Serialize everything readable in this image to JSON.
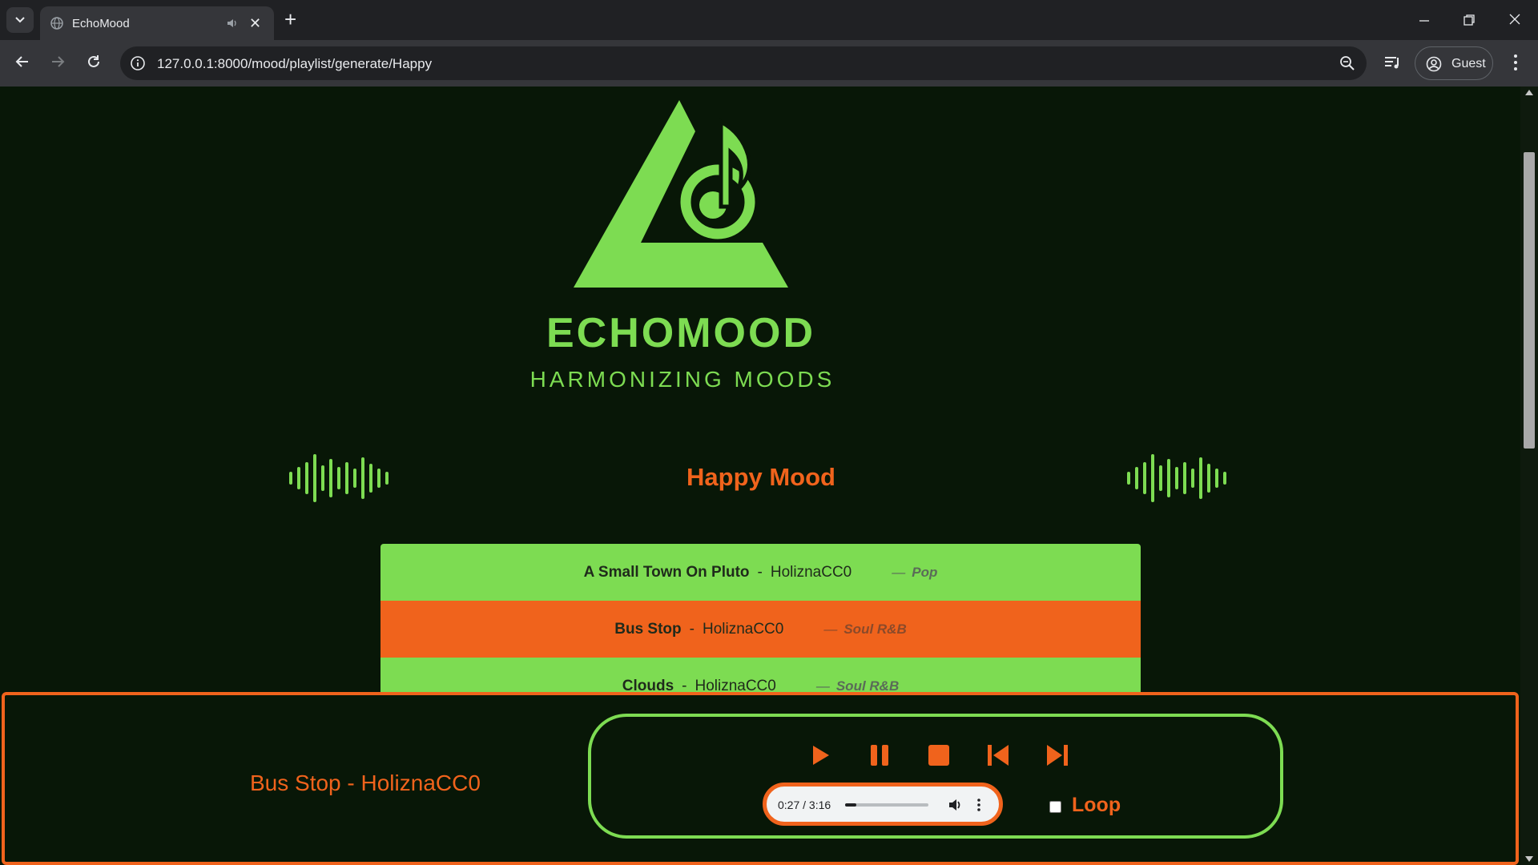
{
  "browser": {
    "tab_title": "EchoMood",
    "url": "127.0.0.1:8000/mood/playlist/generate/Happy",
    "profile_label": "Guest"
  },
  "page": {
    "brand": "ECHOMOOD",
    "tagline": "HARMONIZING MOODS",
    "mood_title": "Happy Mood",
    "playlist": [
      {
        "title": "A Small Town On Pluto",
        "artist": "HoliznaCC0",
        "genre": "Pop",
        "state": "normal"
      },
      {
        "title": "Bus Stop",
        "artist": "HoliznaCC0",
        "genre": "Soul R&B",
        "state": "active"
      },
      {
        "title": "Clouds",
        "artist": "HoliznaCC0",
        "genre": "Soul R&B",
        "state": "normal"
      }
    ],
    "separator": "-",
    "genre_dash": "—"
  },
  "player": {
    "now_playing": "Bus Stop - HoliznaCC0",
    "time_display": "0:27 / 3:16",
    "progress_fraction": 0.138,
    "loop_label": "Loop",
    "loop_checked": false,
    "buttons": [
      "play-icon",
      "pause-icon",
      "stop-icon",
      "skip-previous-icon",
      "skip-next-icon"
    ]
  },
  "colors": {
    "accent_green": "#7ddc52",
    "accent_orange": "#f0631c",
    "background": "#081707"
  }
}
